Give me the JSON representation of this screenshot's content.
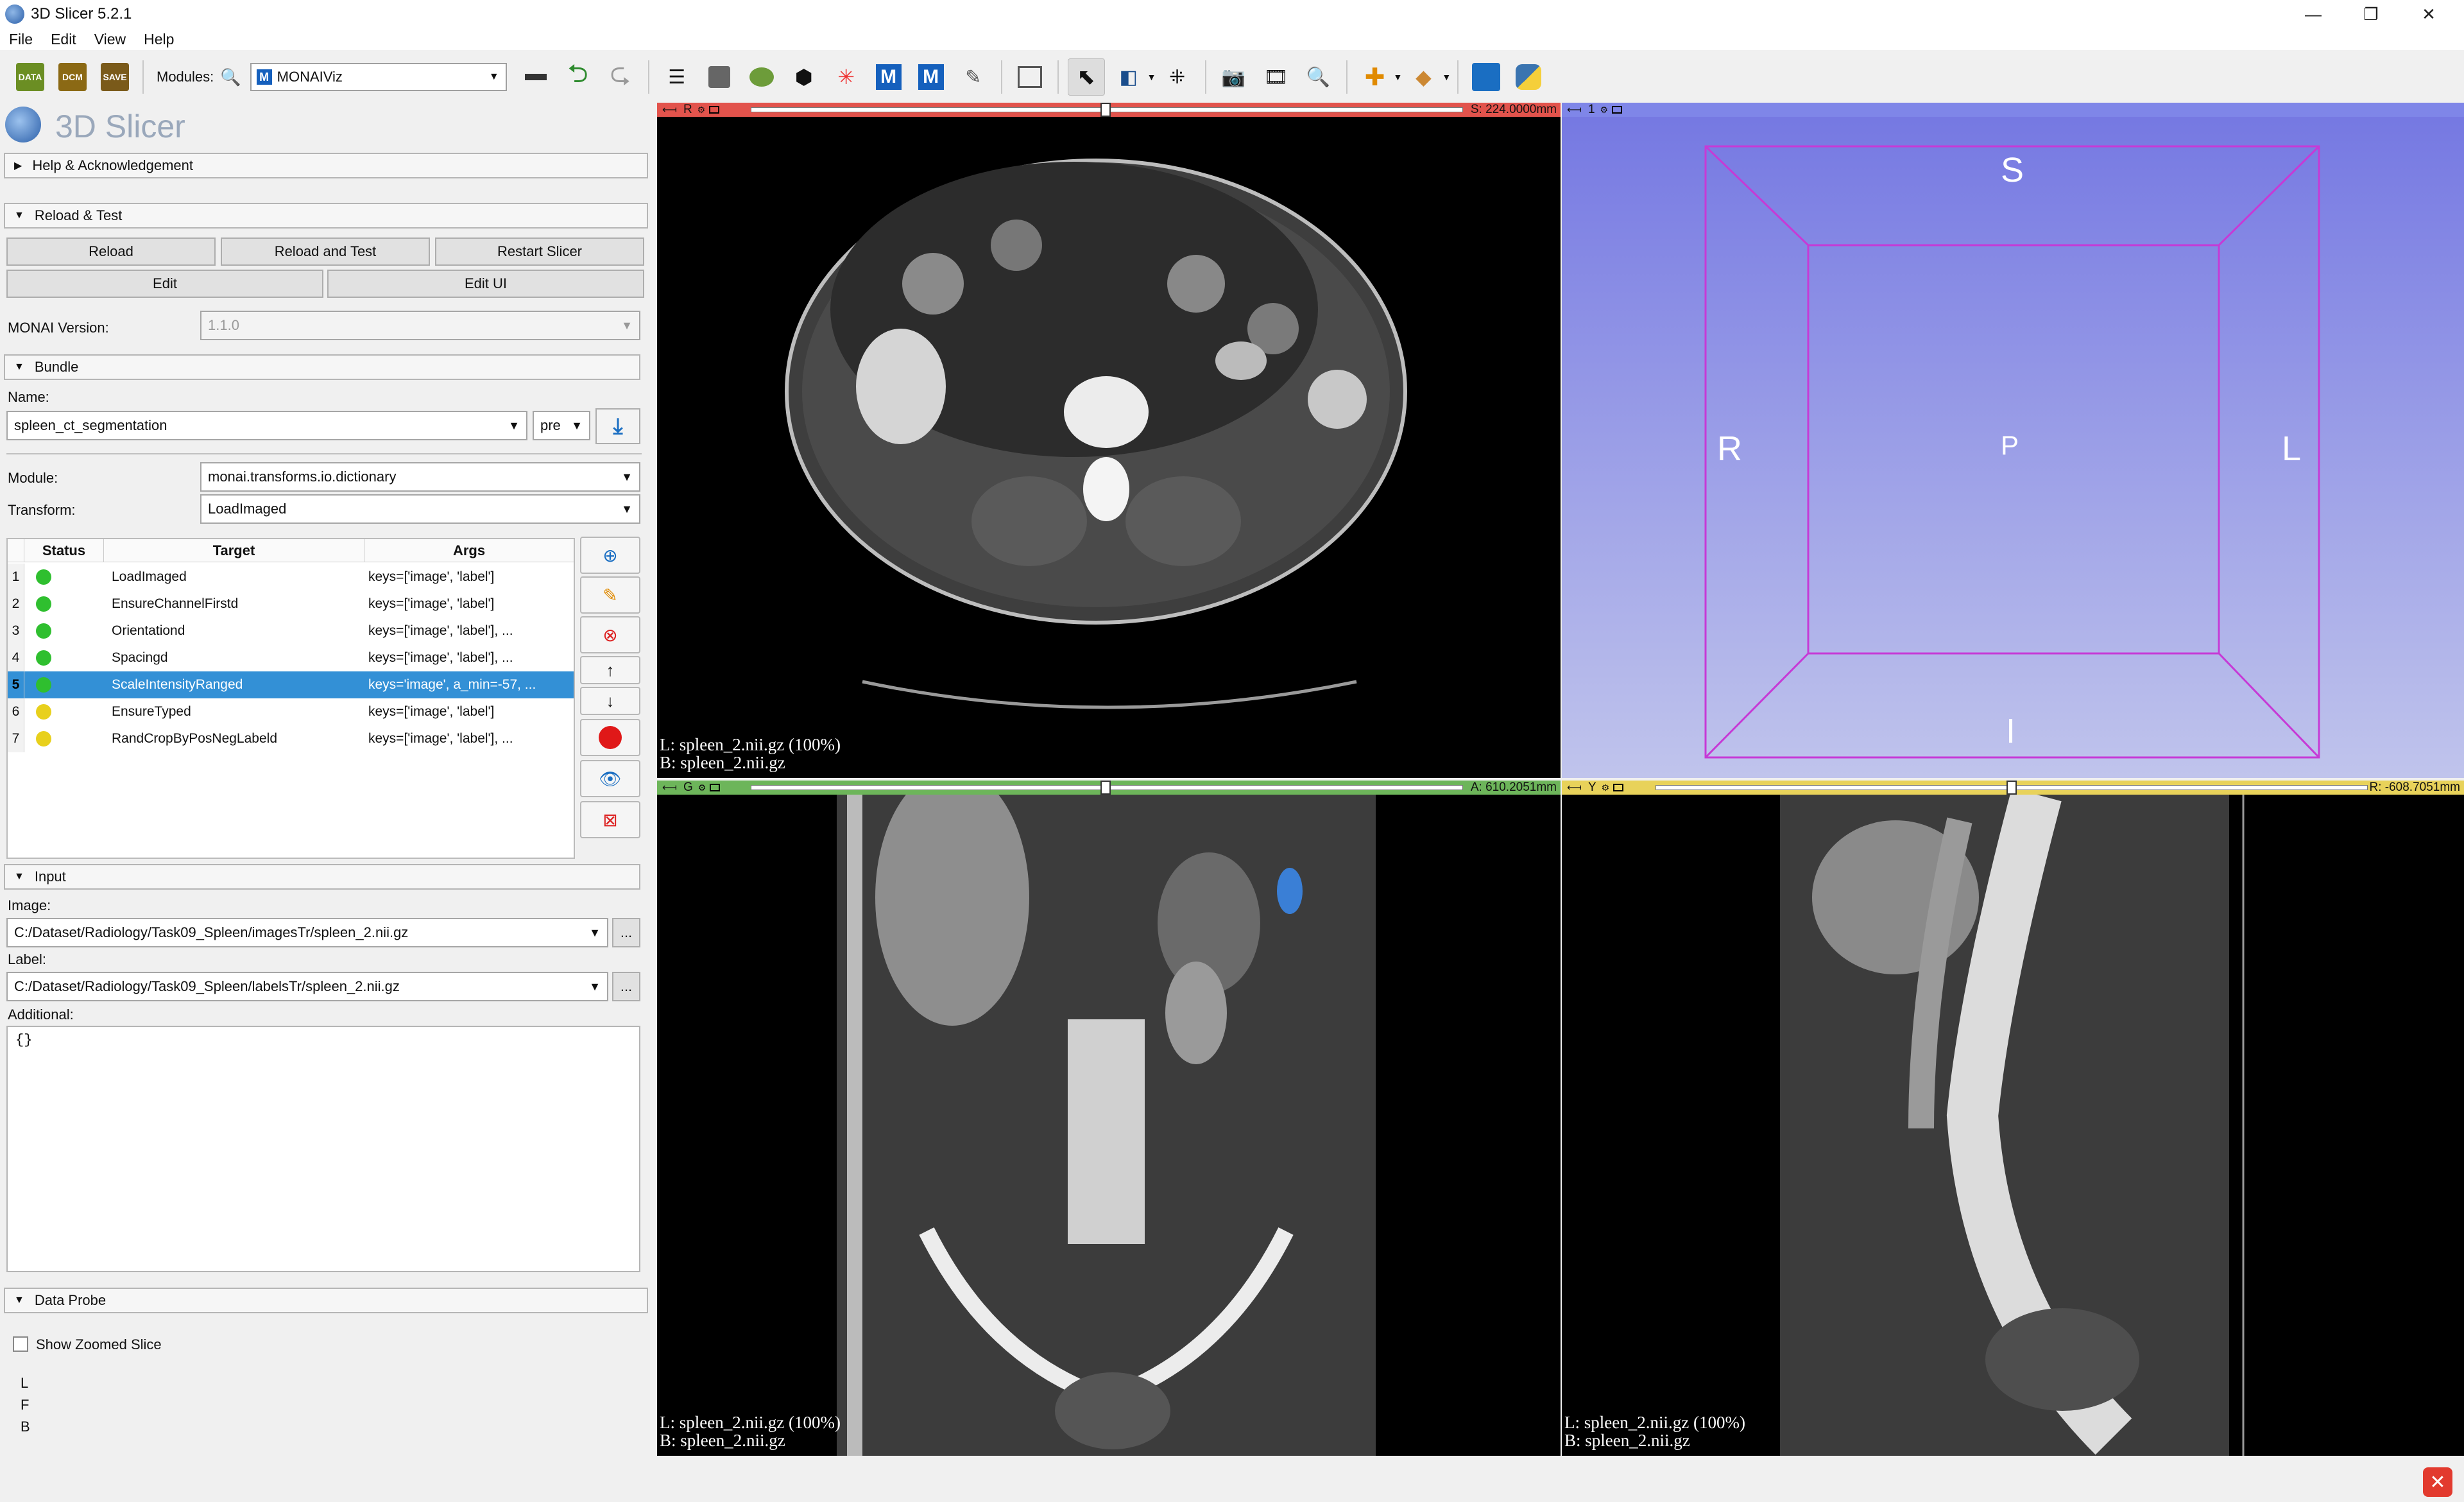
{
  "window": {
    "title": "3D Slicer 5.2.1",
    "controls": {
      "minimize": "—",
      "maximize": "❐",
      "close": "✕"
    }
  },
  "menu": [
    "File",
    "Edit",
    "View",
    "Help"
  ],
  "toolbar": {
    "data_label": "DATA",
    "dcm_label": "DCM",
    "save_label": "SAVE",
    "modules_label": "Modules:",
    "module_selected": "MONAIViz"
  },
  "panel": {
    "logo_text": "3D Slicer",
    "help_section": "Help & Acknowledgement",
    "reload_section": "Reload & Test",
    "reload_btn": "Reload",
    "reload_test_btn": "Reload and Test",
    "restart_btn": "Restart Slicer",
    "edit_btn": "Edit",
    "edit_ui_btn": "Edit UI",
    "monai_version_label": "MONAI Version:",
    "monai_version": "1.1.0",
    "bundle_section": "Bundle",
    "name_label": "Name:",
    "bundle_name": "spleen_ct_segmentation",
    "bundle_stage": "pre",
    "module_label": "Module:",
    "module_value": "monai.transforms.io.dictionary",
    "transform_label": "Transform:",
    "transform_value": "LoadImaged",
    "table": {
      "headers": [
        "Status",
        "Target",
        "Args"
      ],
      "rows": [
        {
          "n": "1",
          "status": "green",
          "target": "LoadImaged",
          "args": "keys=['image', 'label']"
        },
        {
          "n": "2",
          "status": "green",
          "target": "EnsureChannelFirstd",
          "args": "keys=['image', 'label']"
        },
        {
          "n": "3",
          "status": "green",
          "target": "Orientationd",
          "args": "keys=['image', 'label'], ..."
        },
        {
          "n": "4",
          "status": "green",
          "target": "Spacingd",
          "args": "keys=['image', 'label'], ..."
        },
        {
          "n": "5",
          "status": "green",
          "target": "ScaleIntensityRanged",
          "args": "keys='image', a_min=-57, ...",
          "selected": true
        },
        {
          "n": "6",
          "status": "yellow",
          "target": "EnsureTyped",
          "args": "keys=['image', 'label']"
        },
        {
          "n": "7",
          "status": "yellow",
          "target": "RandCropByPosNegLabeld",
          "args": "keys=['image', 'label'], ..."
        }
      ]
    },
    "input_section": "Input",
    "image_label": "Image:",
    "image_path": "C:/Dataset/Radiology/Task09_Spleen/imagesTr/spleen_2.nii.gz",
    "label_label": "Label:",
    "label_path": "C:/Dataset/Radiology/Task09_Spleen/labelsTr/spleen_2.nii.gz",
    "browse": "...",
    "additional_label": "Additional:",
    "additional_value": "{}",
    "probe_section": "Data Probe",
    "show_zoomed": "Show Zoomed Slice",
    "probe_L": "L",
    "probe_F": "F",
    "probe_B": "B"
  },
  "views": {
    "red": {
      "letter": "R",
      "offset": "S: 224.0000mm",
      "fraction": 0.498,
      "line1": "L: spleen_2.nii.gz (100%)",
      "line2": "B: spleen_2.nii.gz"
    },
    "threeD": {
      "id": "1",
      "S": "S",
      "I": "I",
      "R": "R",
      "L": "L",
      "P": "P"
    },
    "green": {
      "letter": "G",
      "offset": "A: 610.2051mm",
      "fraction": 0.498,
      "line1": "L: spleen_2.nii.gz (100%)",
      "line2": "B: spleen_2.nii.gz"
    },
    "yellow": {
      "letter": "Y",
      "offset": "R: -608.7051mm",
      "fraction": 0.5,
      "line1": "L: spleen_2.nii.gz (100%)",
      "line2": "B: spleen_2.nii.gz"
    }
  },
  "colors": {
    "red_bar": "#e2534c",
    "green_bar": "#6db55a",
    "yellow_bar": "#e8d25a",
    "threeD_bar": "#7f86e8",
    "selection": "#3390d6",
    "status_green": "#2fbf2f",
    "status_yellow": "#e8d01c"
  }
}
